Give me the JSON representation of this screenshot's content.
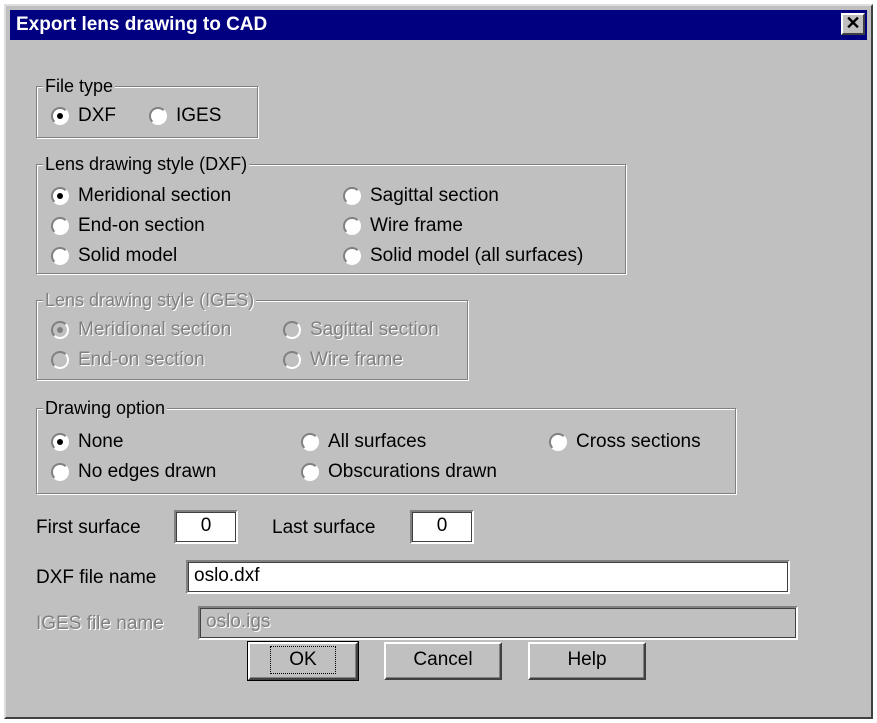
{
  "dialog": {
    "title": "Export lens drawing to CAD",
    "close_glyph": "✕"
  },
  "file_type": {
    "label": "File type",
    "options": [
      "DXF",
      "IGES"
    ],
    "selected": "DXF"
  },
  "dxf_style": {
    "label": "Lens drawing style (DXF)",
    "options": [
      "Meridional section",
      "Sagittal section",
      "End-on section",
      "Wire frame",
      "Solid model",
      "Solid model (all surfaces)"
    ],
    "selected": "Meridional section"
  },
  "iges_style": {
    "label": "Lens drawing style (IGES)",
    "options": [
      "Meridional section",
      "Sagittal section",
      "End-on section",
      "Wire frame"
    ],
    "selected": "Meridional section",
    "enabled": false
  },
  "drawing_option": {
    "label": "Drawing option",
    "options": [
      "None",
      "All surfaces",
      "Cross sections",
      "No edges drawn",
      "Obscurations drawn"
    ],
    "selected": "None"
  },
  "surfaces": {
    "first_label": "First surface",
    "first_value": "0",
    "last_label": "Last surface",
    "last_value": "0"
  },
  "dxf_file": {
    "label": "DXF file name",
    "value": "oslo.dxf"
  },
  "iges_file": {
    "label": "IGES file name",
    "value": "oslo.igs",
    "enabled": false
  },
  "buttons": {
    "ok": "OK",
    "cancel": "Cancel",
    "help": "Help"
  },
  "colors": {
    "titlebar": "#000080",
    "face": "#c0c0c0"
  }
}
